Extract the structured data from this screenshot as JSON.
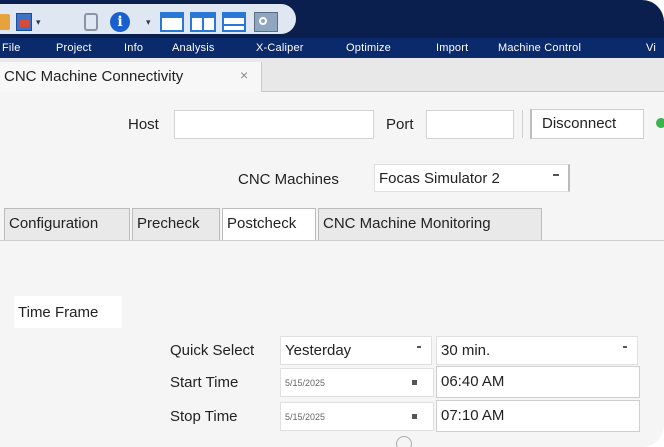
{
  "menu": [
    "File",
    "Project",
    "Info",
    "Analysis",
    "X-Caliper",
    "Optimize",
    "Import",
    "Machine Control",
    "Vi"
  ],
  "document_tab": {
    "title": "CNC Machine Connectivity",
    "close": "×"
  },
  "connection": {
    "host_label": "Host",
    "host_value": "",
    "port_label": "Port",
    "port_value": "",
    "disconnect_label": "Disconnect"
  },
  "cnc": {
    "label": "CNC Machines",
    "selected": "Focas Simulator 2"
  },
  "tabs": [
    "Configuration",
    "Precheck",
    "Postcheck",
    "CNC Machine Monitoring"
  ],
  "active_tab": "Postcheck",
  "time_frame": {
    "title": "Time Frame",
    "quick_select_label": "Quick Select",
    "quick_select_value": "Yesterday",
    "interval_value": "30 min.",
    "start_label": "Start Time",
    "start_date": "5/15/2025",
    "start_time": "06:40 AM",
    "stop_label": "Stop Time",
    "stop_date": "5/15/2025",
    "stop_time": "07:10 AM"
  },
  "colors": {
    "title_bar": "#0a1f4e",
    "menu_bar": "#0b2a6b",
    "status": "#3cb44b"
  }
}
